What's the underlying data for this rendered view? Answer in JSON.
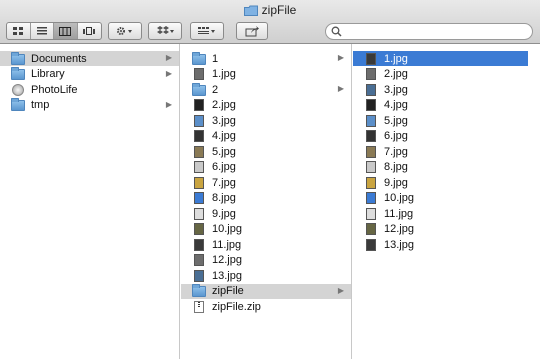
{
  "window": {
    "title": "zipFile"
  },
  "toolbar": {
    "view_buttons": [
      "icon-view-icon",
      "list-view-icon",
      "column-view-icon",
      "cover-flow-icon"
    ],
    "action_icon": "gear-icon",
    "dropbox_icon": "dropbox-icon",
    "arrange_icon": "arrange-icon",
    "share_icon": "share-icon",
    "search": {
      "placeholder": "",
      "icon": "magnifier-icon"
    }
  },
  "columns": [
    {
      "items": [
        {
          "label": "Documents",
          "type": "folder",
          "selected": "inactive",
          "has_children": true
        },
        {
          "label": "Library",
          "type": "folder",
          "has_children": true
        },
        {
          "label": "PhotoLife",
          "type": "app"
        },
        {
          "label": "tmp",
          "type": "folder",
          "has_children": true
        }
      ]
    },
    {
      "items": [
        {
          "label": "1",
          "type": "folder",
          "has_children": true
        },
        {
          "label": "1.jpg",
          "type": "image"
        },
        {
          "label": "2",
          "type": "folder",
          "has_children": true
        },
        {
          "label": "2.jpg",
          "type": "image"
        },
        {
          "label": "3.jpg",
          "type": "image"
        },
        {
          "label": "4.jpg",
          "type": "image"
        },
        {
          "label": "5.jpg",
          "type": "image"
        },
        {
          "label": "6.jpg",
          "type": "image"
        },
        {
          "label": "7.jpg",
          "type": "image"
        },
        {
          "label": "8.jpg",
          "type": "image"
        },
        {
          "label": "9.jpg",
          "type": "image"
        },
        {
          "label": "10.jpg",
          "type": "image"
        },
        {
          "label": "11.jpg",
          "type": "image"
        },
        {
          "label": "12.jpg",
          "type": "image"
        },
        {
          "label": "13.jpg",
          "type": "image"
        },
        {
          "label": "zipFile",
          "type": "folder",
          "selected": "inactive",
          "has_children": true
        },
        {
          "label": "zipFile.zip",
          "type": "zip"
        }
      ]
    },
    {
      "items": [
        {
          "label": "1.jpg",
          "type": "image",
          "selected": "active"
        },
        {
          "label": "2.jpg",
          "type": "image"
        },
        {
          "label": "3.jpg",
          "type": "image"
        },
        {
          "label": "4.jpg",
          "type": "image"
        },
        {
          "label": "5.jpg",
          "type": "image"
        },
        {
          "label": "6.jpg",
          "type": "image"
        },
        {
          "label": "7.jpg",
          "type": "image"
        },
        {
          "label": "8.jpg",
          "type": "image"
        },
        {
          "label": "9.jpg",
          "type": "image"
        },
        {
          "label": "10.jpg",
          "type": "image"
        },
        {
          "label": "11.jpg",
          "type": "image"
        },
        {
          "label": "12.jpg",
          "type": "image"
        },
        {
          "label": "13.jpg",
          "type": "image"
        }
      ]
    }
  ],
  "colors": {
    "selection_active": "#3b7bd4",
    "selection_inactive": "#d4d4d4",
    "folder": "#6ea6d8"
  }
}
